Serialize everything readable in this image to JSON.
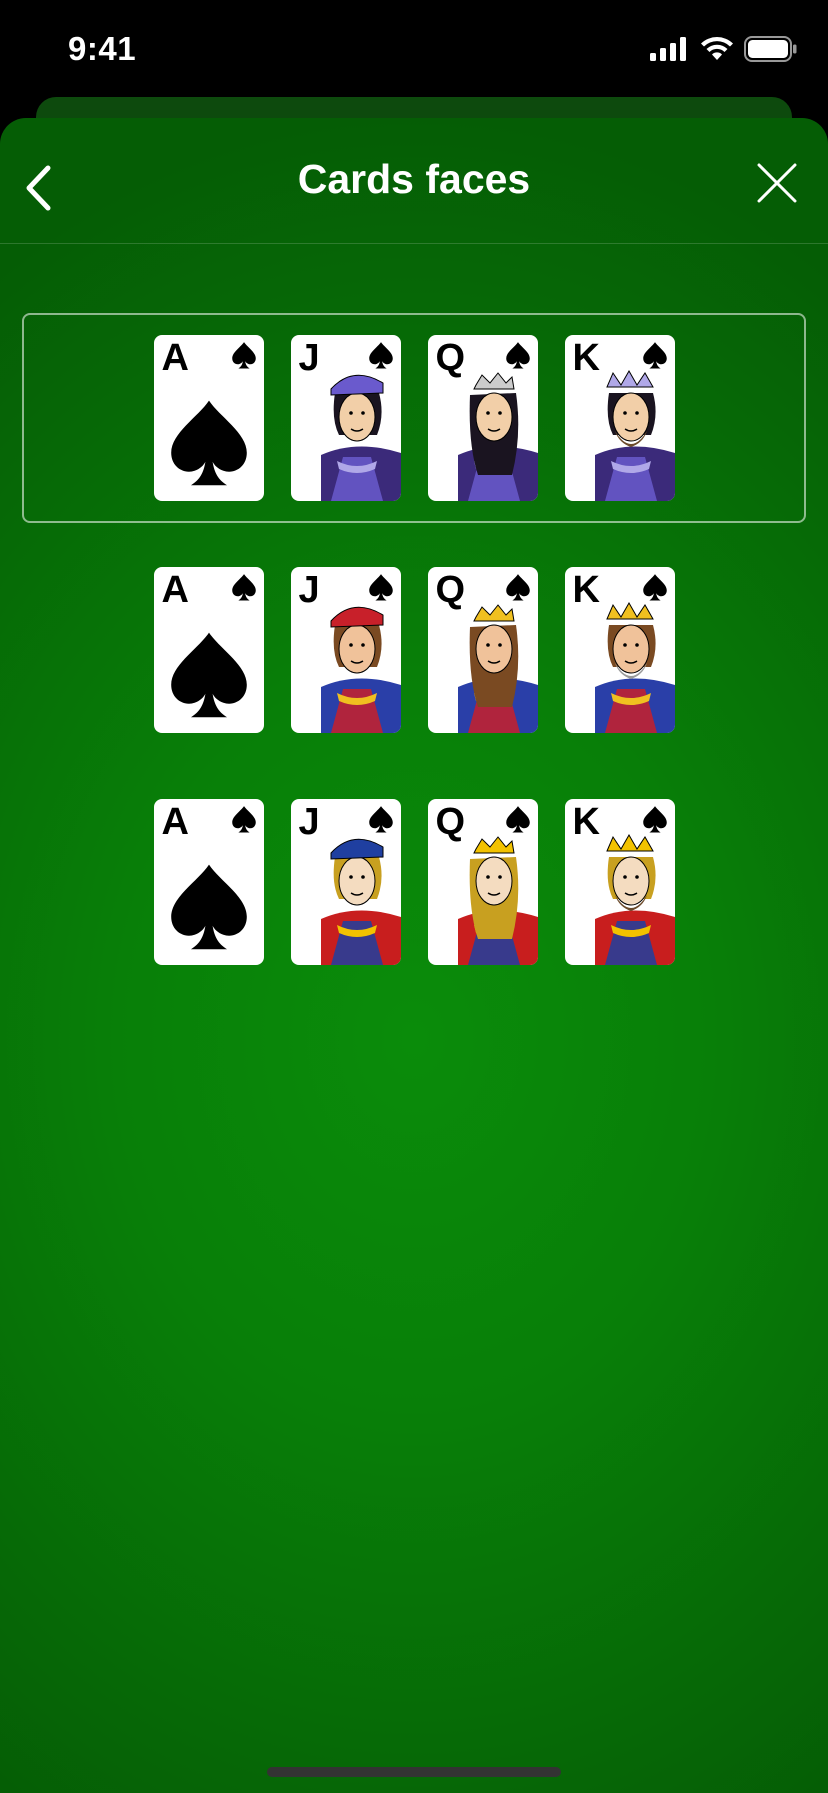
{
  "status": {
    "time": "9:41"
  },
  "nav": {
    "title": "Cards faces"
  },
  "decks": [
    {
      "style": "illustrated-purple",
      "selected": true,
      "cards": [
        {
          "rank": "A",
          "suit": "spade",
          "face": "ace"
        },
        {
          "rank": "J",
          "suit": "spade",
          "face": "jack"
        },
        {
          "rank": "Q",
          "suit": "spade",
          "face": "queen"
        },
        {
          "rank": "K",
          "suit": "spade",
          "face": "king"
        }
      ]
    },
    {
      "style": "classic-cartoon",
      "selected": false,
      "cards": [
        {
          "rank": "A",
          "suit": "spade",
          "face": "ace"
        },
        {
          "rank": "J",
          "suit": "spade",
          "face": "jack"
        },
        {
          "rank": "Q",
          "suit": "spade",
          "face": "queen"
        },
        {
          "rank": "K",
          "suit": "spade",
          "face": "king"
        }
      ]
    },
    {
      "style": "traditional",
      "selected": false,
      "cards": [
        {
          "rank": "A",
          "suit": "spade",
          "face": "ace"
        },
        {
          "rank": "J",
          "suit": "spade",
          "face": "jack"
        },
        {
          "rank": "Q",
          "suit": "spade",
          "face": "queen"
        },
        {
          "rank": "K",
          "suit": "spade",
          "face": "king"
        }
      ]
    }
  ],
  "colors": {
    "table_green": "#087f08",
    "text": "#ffffff"
  }
}
